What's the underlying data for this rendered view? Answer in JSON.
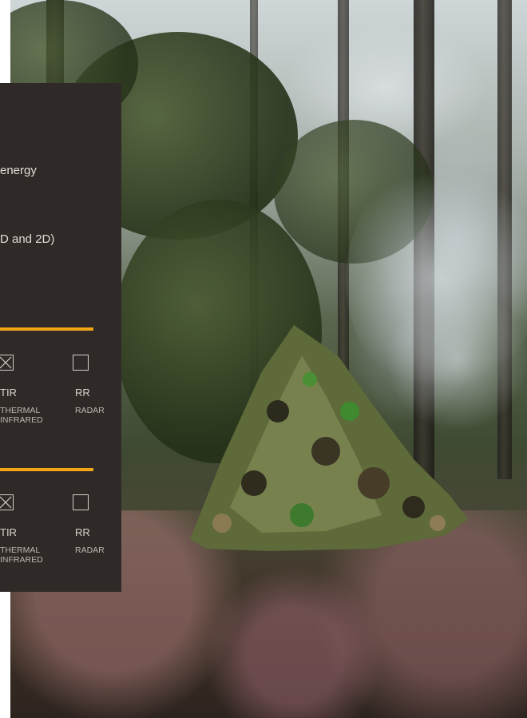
{
  "panel": {
    "line1": "energy",
    "line2": "D and 2D)",
    "groups": [
      {
        "items": [
          {
            "code": "TIR",
            "desc_line1": "THERMAL",
            "desc_line2": "INFRARED",
            "checked": true
          },
          {
            "code": "RR",
            "desc_line1": "RADAR",
            "desc_line2": "",
            "checked": false
          }
        ]
      },
      {
        "items": [
          {
            "code": "TIR",
            "desc_line1": "THERMAL",
            "desc_line2": "INFRARED",
            "checked": true
          },
          {
            "code": "RR",
            "desc_line1": "RADAR",
            "desc_line2": "",
            "checked": false
          }
        ]
      }
    ],
    "accent_color": "#f2a516",
    "background_color": "#2f2927"
  },
  "photo": {
    "subject": "camouflage-net-in-forest"
  }
}
